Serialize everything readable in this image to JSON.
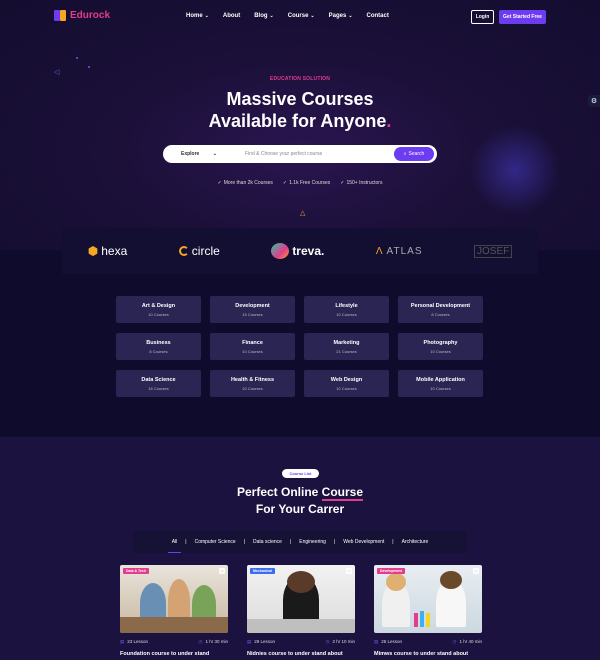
{
  "brand": {
    "name": "Edurock",
    "accent": "#e23c8c",
    "primary": "#6c3cf0"
  },
  "nav": {
    "items": [
      {
        "label": "Home",
        "has_dropdown": true
      },
      {
        "label": "About",
        "has_dropdown": false
      },
      {
        "label": "Blog",
        "has_dropdown": true
      },
      {
        "label": "Course",
        "has_dropdown": true
      },
      {
        "label": "Pages",
        "has_dropdown": true
      },
      {
        "label": "Contact",
        "has_dropdown": false
      }
    ],
    "login": "Login",
    "cta": "Get Started Free"
  },
  "hero": {
    "eyebrow": "EDUCATION SOLUTION",
    "title_line1": "Massive Courses",
    "title_line2": "Available for Anyone",
    "title_dot": ".",
    "search": {
      "select_value": "Explore",
      "placeholder": "Find & Choose your perfect course",
      "button": "Search"
    },
    "stats": [
      "More than 2k Courses",
      "1.1k Free Courses",
      "150+ Instructors"
    ]
  },
  "brands": [
    "hexa",
    "circle",
    "treva.",
    "ATLAS",
    "JOSEF"
  ],
  "categories": [
    {
      "name": "Art & Design",
      "count": "10 Courses"
    },
    {
      "name": "Development",
      "count": "15 Courses"
    },
    {
      "name": "Lifestyle",
      "count": "10 Courses"
    },
    {
      "name": "Personal Development",
      "count": "8 Courses"
    },
    {
      "name": "Business",
      "count": "8 Courses"
    },
    {
      "name": "Finance",
      "count": "10 Courses"
    },
    {
      "name": "Marketing",
      "count": "21 Courses"
    },
    {
      "name": "Photography",
      "count": "10 Courses"
    },
    {
      "name": "Data Science",
      "count": "16 Courses"
    },
    {
      "name": "Health & Fitness",
      "count": "10 Courses"
    },
    {
      "name": "Web Design",
      "count": "10 Courses"
    },
    {
      "name": "Mobile Application",
      "count": "10 Courses"
    }
  ],
  "course_section": {
    "badge": "Course List",
    "title_line1_plain": "Perfect Online ",
    "title_line1_underlined": "Course",
    "title_line2": "For Your Carrer",
    "filters": [
      "All",
      "Computer Science",
      "Data science",
      "Engineering",
      "Web Development",
      "Architecture"
    ],
    "active_filter": "All",
    "cards": [
      {
        "tag": "Data & Tech",
        "tag_color": "#e23c8c",
        "lessons": "23 Lesson",
        "duration": "1 hr 30 min",
        "title": "Foundation course to under stand"
      },
      {
        "tag": "Mechanical",
        "tag_color": "#3c6cf0",
        "lessons": "29 Lesson",
        "duration": "2 hr 10 min",
        "title": "Nidnies course to under stand about"
      },
      {
        "tag": "Development",
        "tag_color": "#e23c8c",
        "lessons": "25 Lesson",
        "duration": "1 hr 40 min",
        "title": "Mimws course to under stand about"
      }
    ]
  }
}
